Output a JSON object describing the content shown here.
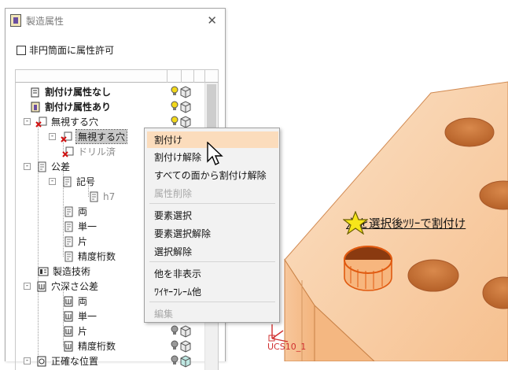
{
  "panel": {
    "title": "製造属性",
    "close_glyph": "✕",
    "checkbox_label": "非円筒面に属性許可"
  },
  "tree": {
    "items": [
      {
        "label": "割付け属性なし"
      },
      {
        "label": "割付け属性あり"
      },
      {
        "label": "無視する穴"
      },
      {
        "label": "無視する穴"
      },
      {
        "label": "ドリル済"
      },
      {
        "label": "公差"
      },
      {
        "label": "記号"
      },
      {
        "label": "h7"
      },
      {
        "label": "両"
      },
      {
        "label": "単一"
      },
      {
        "label": "片"
      },
      {
        "label": "精度桁数"
      },
      {
        "label": "製造技術"
      },
      {
        "label": "穴深さ公差"
      },
      {
        "label": "両"
      },
      {
        "label": "単一"
      },
      {
        "label": "片"
      },
      {
        "label": "精度桁数"
      },
      {
        "label": "正確な位置"
      }
    ]
  },
  "context_menu": {
    "items": [
      {
        "label": "割付け"
      },
      {
        "label": "割付け解除"
      },
      {
        "label": "すべての面から割付け解除"
      },
      {
        "label": "属性削除"
      },
      {
        "label": "要素選択"
      },
      {
        "label": "要素選択解除"
      },
      {
        "label": "選択解除"
      },
      {
        "label": "他を非表示"
      },
      {
        "label": "ﾜｲﾔｰﾌﾚｰﾑ他"
      },
      {
        "label": "編集"
      }
    ]
  },
  "viewport": {
    "callout_text": "穴を選択後ﾂﾘｰで割付け",
    "ucs_label": "UCS10_1"
  },
  "colors": {
    "model_face": "#f8c9a0",
    "model_edge": "#c46a2a",
    "menu_highlight": "#fbdcbc",
    "hole_selected": "#e05a10",
    "star": "#f7e51a"
  }
}
